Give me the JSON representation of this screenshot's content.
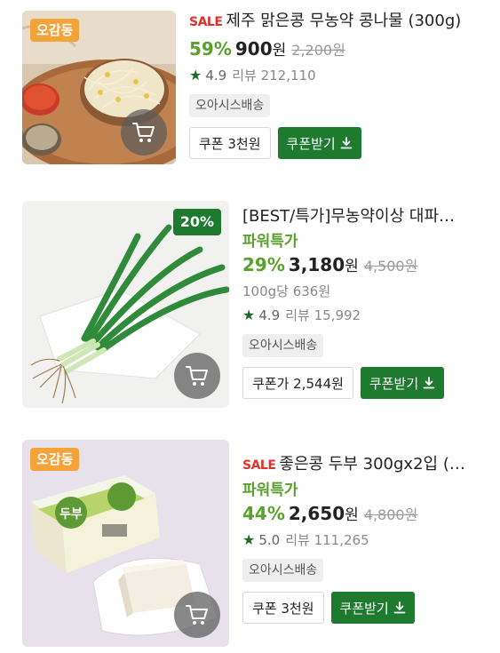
{
  "products": [
    {
      "badge": "오감동",
      "sale_tag": "SALE",
      "title": "제주 맑은콩 무농약 콩나물 (300g)",
      "discount": "59%",
      "price": "900",
      "won": "원",
      "original_price": "2,200원",
      "rating": "4.9",
      "review_label": "리뷰",
      "review_count": "212,110",
      "delivery": "오아시스배송",
      "coupon_label": "쿠폰 3천원",
      "get_coupon_label": "쿠폰받기",
      "image_icon": "bean-sprouts-image"
    },
    {
      "badge": "20%",
      "title": "[BEST/특가]무농약이상 대파…",
      "power_label": "파워특가",
      "discount": "29%",
      "price": "3,180",
      "won": "원",
      "original_price": "4,500원",
      "unit_price": "100g당 636원",
      "rating": "4.9",
      "review_label": "리뷰",
      "review_count": "15,992",
      "delivery": "오아시스배송",
      "coupon_label": "쿠폰가 2,544원",
      "get_coupon_label": "쿠폰받기",
      "image_icon": "green-onion-image"
    },
    {
      "badge": "오감동",
      "sale_tag": "SALE",
      "title": "좋은콩 두부 300gx2입 (…",
      "power_label": "파워특가",
      "discount": "44%",
      "price": "2,650",
      "won": "원",
      "original_price": "4,800원",
      "rating": "5.0",
      "review_label": "리뷰",
      "review_count": "111,265",
      "delivery": "오아시스배송",
      "coupon_label": "쿠폰 3천원",
      "get_coupon_label": "쿠폰받기",
      "tofu_pack_text": "두부",
      "image_icon": "tofu-image"
    }
  ],
  "colors": {
    "accent_green": "#1e7a2e",
    "discount_green": "#5aa02c",
    "sale_red": "#e0312b",
    "badge_orange": "#f4a23a"
  }
}
